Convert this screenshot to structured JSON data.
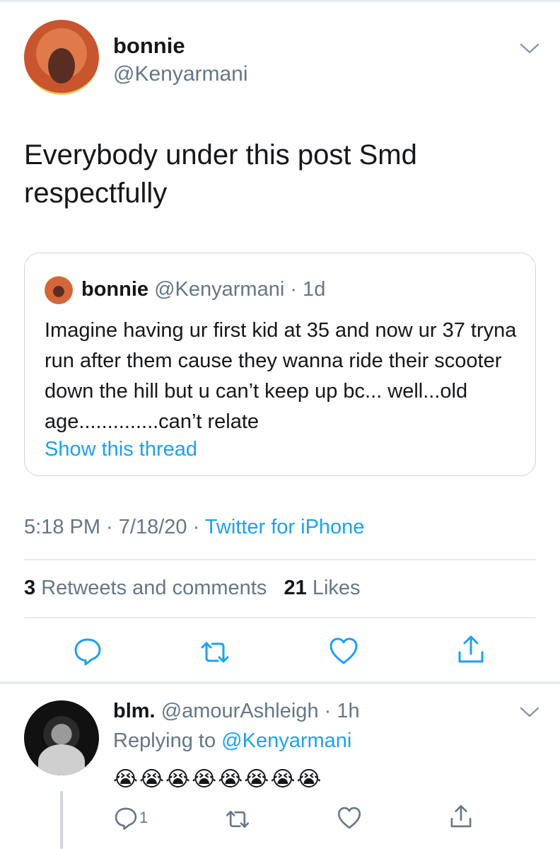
{
  "tweet": {
    "author_name": "bonnie",
    "author_handle": "@Kenyarmani",
    "text": "Everybody under this post Smd respectfully",
    "timestamp": "5:18 PM · 7/18/20 · ",
    "source": "Twitter for iPhone",
    "retweets_count": "3",
    "retweets_label": "Retweets and comments",
    "likes_count": "21",
    "likes_label": "Likes"
  },
  "quote": {
    "author_name": "bonnie",
    "meta": "@Kenyarmani · 1d",
    "text": "Imagine having ur first kid at 35 and now ur 37 tryna run after them cause they wanna ride their scooter down the hill but u can’t keep up bc... well...old age..............can’t relate",
    "link": "Show this thread"
  },
  "reply": {
    "author_name": "blm.",
    "meta": "@amourAshleigh · 1h",
    "replying_prefix": "Replying to ",
    "replying_to": "@Kenyarmani",
    "text": "😭😭😭😭😭😭😭😭",
    "reply_count": "1"
  },
  "icons": {
    "reply": "comment-icon",
    "retweet": "retweet-icon",
    "like": "heart-icon",
    "share": "share-icon",
    "menu": "chevron-down-icon"
  },
  "colors": {
    "accent": "#1da1f2",
    "secondary_text": "#657786",
    "primary_text": "#14171a",
    "border": "#e6ecf0"
  }
}
